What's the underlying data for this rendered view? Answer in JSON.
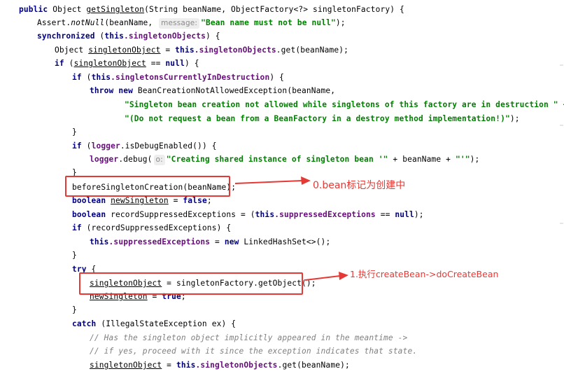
{
  "code": {
    "l1": {
      "kw": "public",
      "type": " Object ",
      "method": "getSingleton",
      "rest": "(String beanName, ObjectFactory<?> singletonFactory) {"
    },
    "l2": {
      "a": "Assert.",
      "m": "notNull",
      "b": "(beanName,",
      "hint": "message:",
      "s": "\"Bean name must not be null\"",
      "end": ");"
    },
    "l3": {
      "kw": "synchronized",
      "a": " (",
      "kw2": "this",
      "f": ".singletonObjects",
      "end": ") {"
    },
    "l4": {
      "a": "Object ",
      "v": "singletonObject",
      "b": " = ",
      "kw": "this",
      "f": ".singletonObjects",
      "end": ".get(beanName);"
    },
    "l5": {
      "kw": "if",
      "a": " (",
      "v": "singletonObject",
      "b": " == ",
      "kw2": "null",
      "end": ") {"
    },
    "l6": {
      "kw": "if",
      "a": " (",
      "kw2": "this",
      "f": ".singletonsCurrentlyInDestruction",
      "end": ") {"
    },
    "l7": {
      "kw": "throw new",
      "end": " BeanCreationNotAllowedException(beanName,"
    },
    "l8": {
      "s": "\"Singleton bean creation not allowed while singletons of this factory are in destruction \" +"
    },
    "l9": {
      "s": "\"(Do not request a bean from a BeanFactory in a destroy method implementation!)\"",
      "end": ");"
    },
    "l10": {
      "t": "}"
    },
    "l11": {
      "kw": "if",
      "a": " (",
      "f": "logger",
      "end": ".isDebugEnabled()) {"
    },
    "l12": {
      "f": "logger",
      "a": ".debug(",
      "hint": "o:",
      "s": "\"Creating shared instance of singleton bean '\"",
      "b": " + beanName + ",
      "s2": "\"'\"",
      "end": ");"
    },
    "l13": {
      "t": "}"
    },
    "l14": {
      "t": "beforeSingletonCreation(beanName);"
    },
    "l15": {
      "kw": "boolean",
      "a": " ",
      "v": "newSingleton",
      "b": " = ",
      "kw2": "false",
      "end": ";"
    },
    "l16": {
      "kw": "boolean",
      "a": " recordSuppressedExceptions = (",
      "kw2": "this",
      "f": ".suppressedExceptions",
      "b": " == ",
      "kw3": "null",
      "end": ");"
    },
    "l17": {
      "kw": "if",
      "end": " (recordSuppressedExceptions) {"
    },
    "l18": {
      "kw": "this",
      "f": ".suppressedExceptions",
      "a": " = ",
      "kw2": "new",
      "end": " LinkedHashSet<>();"
    },
    "l19": {
      "t": "}"
    },
    "l20": {
      "kw": "try",
      "end": " {"
    },
    "l21": {
      "v": "singletonObject",
      "end": " = singletonFactory.getObject();"
    },
    "l22": {
      "v": "newSingleton",
      "a": " = ",
      "kw": "true",
      "end": ";"
    },
    "l23": {
      "t": "}"
    },
    "l24": {
      "kw": "catch",
      "end": " (IllegalStateException ex) {"
    },
    "l25": {
      "c": "// Has the singleton object implicitly appeared in the meantime ->"
    },
    "l26": {
      "c": "// if yes, proceed with it since the exception indicates that state."
    },
    "l27": {
      "v": "singletonObject",
      "a": " = ",
      "kw": "this",
      "f": ".singletonObjects",
      "end": ".get(beanName);"
    }
  },
  "annotations": {
    "note1": "0.bean标记为创建中",
    "note2": "1.执行createBean->doCreateBean"
  },
  "colors": {
    "keyword": "#000080",
    "field": "#660e7a",
    "string": "#008000",
    "comment": "#808080",
    "annotation": "#e53935"
  }
}
